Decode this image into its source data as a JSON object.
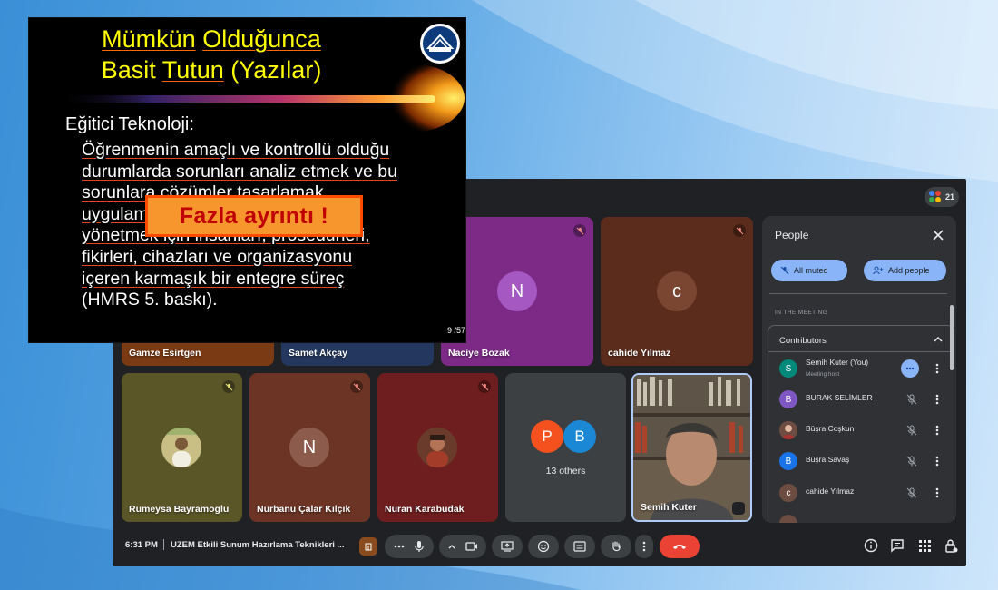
{
  "meeting": {
    "participant_count": "21",
    "tiles": [
      {
        "name": "Gamze Esirtgen",
        "color": "#7a3a13"
      },
      {
        "name": "Samet Akçay",
        "color": "#24375e"
      },
      {
        "name": "Naciye Bozak",
        "initial": "N",
        "color": "#7c2a86",
        "avatar_color": "#a557c2"
      },
      {
        "name": "cahide Yılmaz",
        "initial": "c",
        "color": "#5b2c1c",
        "avatar_color": "#7a4632"
      },
      {
        "name": "Rumeysa Bayramoglu",
        "color": "#5a5628"
      },
      {
        "name": "Nurbanu Çalar Kılçık",
        "initial": "N",
        "color": "#6b3424",
        "avatar_color": "#8d5b4c"
      },
      {
        "name": "Nuran Karabudak",
        "color": "#6e1e1e"
      },
      {
        "name": "Semih Kuter",
        "color": "#6d6a62"
      }
    ],
    "others": {
      "initials": [
        "P",
        "B"
      ],
      "colors": [
        "#f4511e",
        "#1a88d4"
      ],
      "label": "13 others"
    }
  },
  "people_panel": {
    "title": "People",
    "all_muted_label": "All muted",
    "add_people_label": "Add people",
    "in_the_meeting_label": "IN THE MEETING",
    "contributors_label": "Contributors",
    "people": [
      {
        "name": "Semih Kuter (You)",
        "role": "Meeting host",
        "initial": "S",
        "color": "#00897b"
      },
      {
        "name": "BURAK SELİMLER",
        "initial": "B",
        "color": "#7e57c2"
      },
      {
        "name": "Büşra Coşkun",
        "initial": "",
        "color": "#6d4c41"
      },
      {
        "name": "Büşra Savaş",
        "initial": "B",
        "color": "#1a73e8"
      },
      {
        "name": "cahide Yılmaz",
        "initial": "c",
        "color": "#6d4c41"
      }
    ]
  },
  "bottom_bar": {
    "time": "6:31 PM",
    "meeting_title": "UZEM Etkili Sunum Hazırlama Teknikleri ..."
  },
  "slide": {
    "title_line1_a": "Mümkün",
    "title_line1_b": "Olduğunca",
    "title_line2_a": "Basit",
    "title_line2_b": "Tutun",
    "title_line2_c": "(Yazılar)",
    "heading": "Eğitici Teknoloji:",
    "body_lines": [
      "Öğrenmenin amaçlı ve kontrollü olduğu",
      "durumlarda sorunları analiz etmek ve bu",
      "sorunlara çözümler tasarlamak,",
      "uygulamak, değerlendirmek ve",
      "yönetmek için insanları, prosedürleri,",
      "fikirleri, cihazları ve organizasyonu",
      "içeren karmaşık bir entegre süreç",
      "(HMRS 5. baskı)."
    ],
    "page": "9 /57",
    "callout": "Fazla ayrıntı !"
  }
}
